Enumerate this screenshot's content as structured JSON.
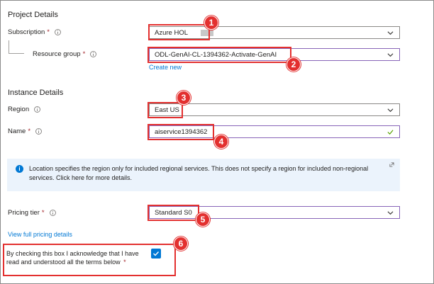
{
  "project_details": {
    "title": "Project Details",
    "subscription": {
      "label": "Subscription",
      "value": "Azure HOL",
      "badge": "1"
    },
    "resource_group": {
      "label": "Resource group",
      "value": "ODL-GenAI-CL-1394362-Activate-GenAI",
      "create_new": "Create new",
      "badge": "2"
    }
  },
  "instance_details": {
    "title": "Instance Details",
    "region": {
      "label": "Region",
      "value": "East US",
      "badge": "3"
    },
    "name": {
      "label": "Name",
      "value": "aiservice1394362",
      "badge": "4"
    }
  },
  "info_message": "Location specifies the region only for included regional services. This does not specify a region for included non-regional services. Click here for more details.",
  "pricing": {
    "label": "Pricing tier",
    "value": "Standard S0",
    "badge": "5",
    "view_details": "View full pricing details"
  },
  "acknowledge": {
    "text": "By checking this box I acknowledge that I have read and understood all the terms below",
    "required_mark": "*",
    "checked": true,
    "badge": "6"
  },
  "required_mark": "*",
  "colors": {
    "accent": "#0078d4",
    "callout": "#e3302f",
    "focus": "#8764b8",
    "valid": "#57a300"
  }
}
